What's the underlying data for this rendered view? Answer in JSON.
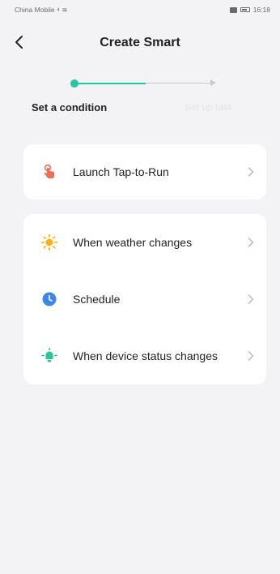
{
  "status_bar": {
    "carrier": "China Mobile",
    "time": "16:18"
  },
  "header": {
    "title": "Create Smart"
  },
  "stepper": {
    "step1_label": "Set a condition",
    "step2_label": "Set up task"
  },
  "cards": {
    "tap_to_run": {
      "label": "Launch Tap-to-Run",
      "icon": "tap-hand-icon"
    },
    "weather": {
      "label": "When weather changes",
      "icon": "sun-icon"
    },
    "schedule": {
      "label": "Schedule",
      "icon": "clock-icon"
    },
    "device_status": {
      "label": "When device status changes",
      "icon": "device-icon"
    }
  },
  "colors": {
    "accent": "#22c6a0",
    "tap_icon": "#ef6f56",
    "sun_icon": "#ffb11a",
    "clock_icon": "#3d86e8",
    "device_icon": "#2ac59a"
  }
}
